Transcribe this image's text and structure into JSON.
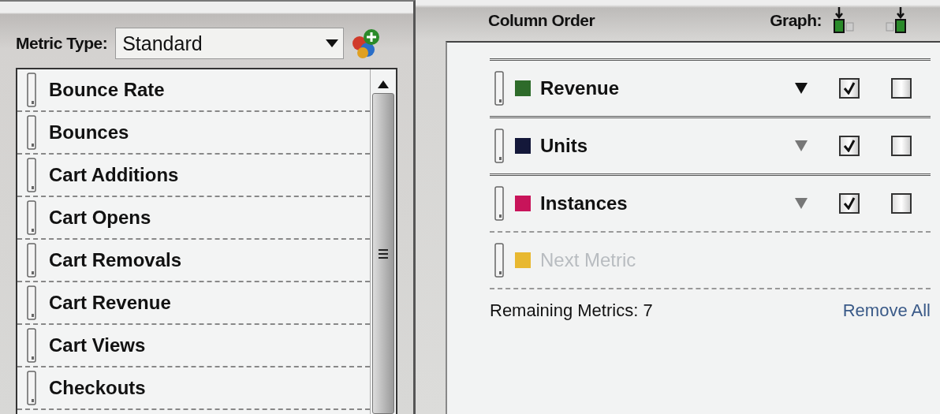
{
  "metric_type": {
    "label": "Metric Type:",
    "value": "Standard"
  },
  "metrics": [
    "Bounce Rate",
    "Bounces",
    "Cart Additions",
    "Cart Opens",
    "Cart Removals",
    "Cart Revenue",
    "Cart Views",
    "Checkouts"
  ],
  "column_order": {
    "title": "Column Order",
    "graph_label": "Graph:",
    "columns": [
      {
        "kind": "metric",
        "name": "Revenue",
        "color": "#2e6b2a",
        "selected": true,
        "checks": [
          true,
          false
        ]
      },
      {
        "kind": "metric",
        "name": "Units",
        "color": "#14183a",
        "selected": false,
        "checks": [
          true,
          false
        ]
      },
      {
        "kind": "metric",
        "name": "Instances",
        "color": "#c8145a",
        "selected": false,
        "checks": [
          true,
          false
        ]
      },
      {
        "kind": "placeholder",
        "name": "Next Metric",
        "color": "#e8b830"
      }
    ],
    "remaining": "Remaining Metrics: 7",
    "remove_all": "Remove All"
  }
}
